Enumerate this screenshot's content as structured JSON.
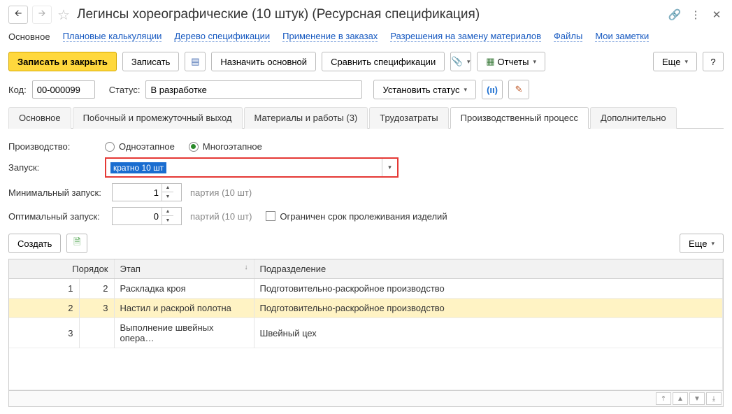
{
  "title": "Легинсы хореографические (10 штук) (Ресурсная спецификация)",
  "linkbar": {
    "main": "Основное",
    "links": [
      "Плановые калькуляции",
      "Дерево спецификации",
      "Применение в заказах",
      "Разрешения на замену материалов",
      "Файлы",
      "Мои заметки"
    ]
  },
  "toolbar": {
    "save_close": "Записать и закрыть",
    "save": "Записать",
    "assign_main": "Назначить основной",
    "compare": "Сравнить спецификации",
    "reports": "Отчеты",
    "more": "Еще",
    "help": "?"
  },
  "form": {
    "code_label": "Код:",
    "code_value": "00-000099",
    "status_label": "Статус:",
    "status_value": "В разработке",
    "set_status": "Установить статус"
  },
  "tabs": [
    "Основное",
    "Побочный и промежуточный выход",
    "Материалы и работы (3)",
    "Трудозатраты",
    "Производственный процесс",
    "Дополнительно"
  ],
  "active_tab": 4,
  "production": {
    "label": "Производство:",
    "single": "Одноэтапное",
    "multi": "Многоэтапное"
  },
  "launch": {
    "label": "Запуск:",
    "value": "кратно 10 шт"
  },
  "min_launch": {
    "label": "Минимальный запуск:",
    "value": "1",
    "unit": "партия (10 шт)"
  },
  "opt_launch": {
    "label": "Оптимальный запуск:",
    "value": "0",
    "unit": "партий (10 шт)",
    "checkbox": "Ограничен срок пролеживания изделий"
  },
  "grid_toolbar": {
    "create": "Создать",
    "more": "Еще"
  },
  "grid": {
    "headers": [
      "Порядок",
      "",
      "Этап",
      "Подразделение"
    ],
    "rows": [
      {
        "order": "1",
        "seq": "2",
        "stage": "Раскладка кроя",
        "dept": "Подготовительно-раскройное производство"
      },
      {
        "order": "2",
        "seq": "3",
        "stage": "Настил и раскрой полотна",
        "dept": "Подготовительно-раскройное производство"
      },
      {
        "order": "3",
        "seq": "",
        "stage": "Выполнение швейных опера…",
        "dept": "Швейный цех"
      }
    ]
  }
}
